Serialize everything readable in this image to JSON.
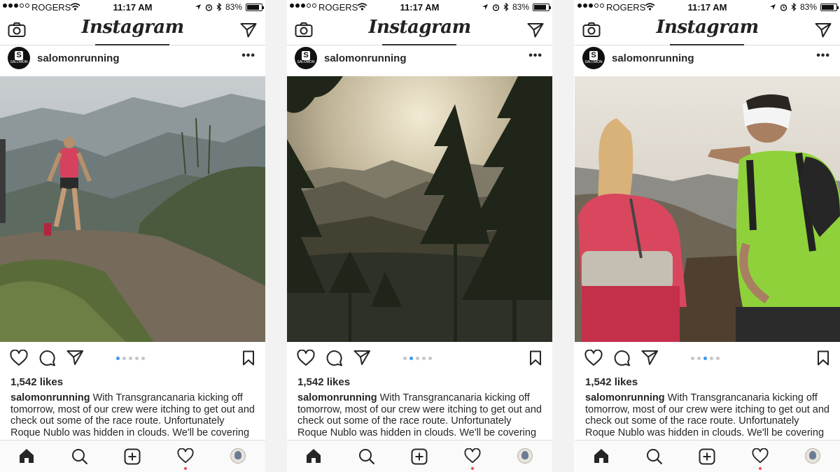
{
  "status": {
    "carrier": "ROGERS",
    "time": "11:17 AM",
    "battery": "83%",
    "battery_level": 0.83
  },
  "nav": {
    "logo": "Instagram",
    "camera_icon": "camera-icon",
    "direct_icon": "paper-plane-icon"
  },
  "post": {
    "username": "salomonrunning",
    "avatar_letter": "S",
    "avatar_word": "SALOMON",
    "more": "•••",
    "likes": "1,542 likes",
    "caption_user": "salomonrunning",
    "caption_text": " With Transgrancanaria kicking off tomorrow, most of our crew were itching to get out and check out some of the race route. Unfortunately Roque Nublo was hidden in clouds. We'll be covering"
  },
  "screens": [
    {
      "photo": "trail-runner-on-mountain-path",
      "active_dot": 0
    },
    {
      "photo": "pine-trees-at-sunset-over-mountains",
      "active_dot": 1
    },
    {
      "photo": "two-runners-looking-at-view",
      "active_dot": 2
    }
  ],
  "tabbar": [
    "home-icon",
    "search-icon",
    "add-post-icon",
    "heart-icon",
    "profile-avatar"
  ],
  "colors": {
    "accent_blue": "#3897f0",
    "notification_red": "#ed4956",
    "divider": "#dbdbdb"
  }
}
